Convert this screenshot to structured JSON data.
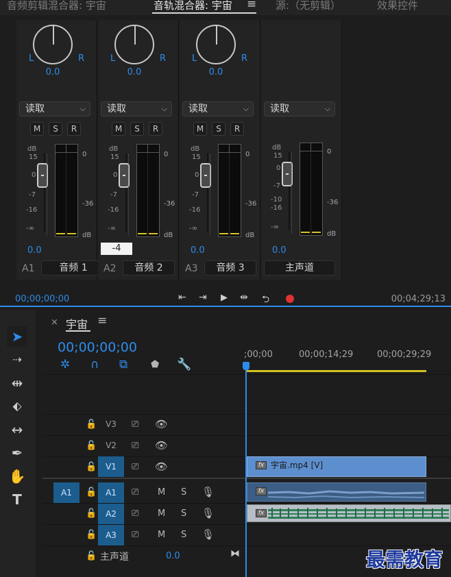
{
  "tabs": [
    {
      "label": "音频剪辑混合器: 宇宙"
    },
    {
      "label": "音轨混合器: 宇宙"
    },
    {
      "label": "源:（无剪辑）"
    },
    {
      "label": "效果控件"
    }
  ],
  "tab_menu_icon": "≡",
  "mixer": {
    "pan_left": "L",
    "pan_right": "R",
    "strips": [
      {
        "pan": "0.0",
        "mode": "读取",
        "m": "M",
        "s": "S",
        "r": "R",
        "volume": "0.0",
        "id": "A1",
        "name": "音频 1"
      },
      {
        "pan": "0.0",
        "mode": "读取",
        "m": "M",
        "s": "S",
        "r": "R",
        "volume": "-4",
        "id": "A2",
        "name": "音频 2"
      },
      {
        "pan": "0.0",
        "mode": "读取",
        "m": "M",
        "s": "S",
        "r": "R",
        "volume": "0.0",
        "id": "A3",
        "name": "音频 3"
      },
      {
        "pan": "",
        "mode": "读取",
        "volume": "0.0",
        "id": "",
        "name": "主声道"
      }
    ],
    "scale_labels": {
      "db": "dB",
      "p15": "15",
      "zero": "0",
      "m7": "-7",
      "m10": "-10",
      "m16": "-16",
      "inf": "-∞",
      "m36": "-36"
    }
  },
  "transport": {
    "timecode_left": "00;00;00;00",
    "timecode_right": "00;04;29;13"
  },
  "timeline": {
    "close": "×",
    "sequence_name": "宇宙",
    "menu": "≡",
    "timecode": "00;00;00;00",
    "ruler": [
      ";00;00",
      "00;00;14;29",
      "00;00;29;29"
    ],
    "tracks": [
      {
        "name": "V3"
      },
      {
        "name": "V2"
      },
      {
        "name": "V1"
      },
      {
        "name": "A1",
        "m": "M",
        "s": "S"
      },
      {
        "name": "A2",
        "m": "M",
        "s": "S"
      },
      {
        "name": "A3",
        "m": "M",
        "s": "S"
      }
    ],
    "source_patch": "A1",
    "master": {
      "label": "主声道",
      "value": "0.0"
    },
    "video_clip": "宇宙.mp4 [V]",
    "fx": "fx"
  },
  "watermark": "最需教育",
  "colors": {
    "accent": "#2d8ceb",
    "record": "#e03232",
    "video_clip": "#5d8fcf",
    "meter_peak": "#d9c12c"
  }
}
